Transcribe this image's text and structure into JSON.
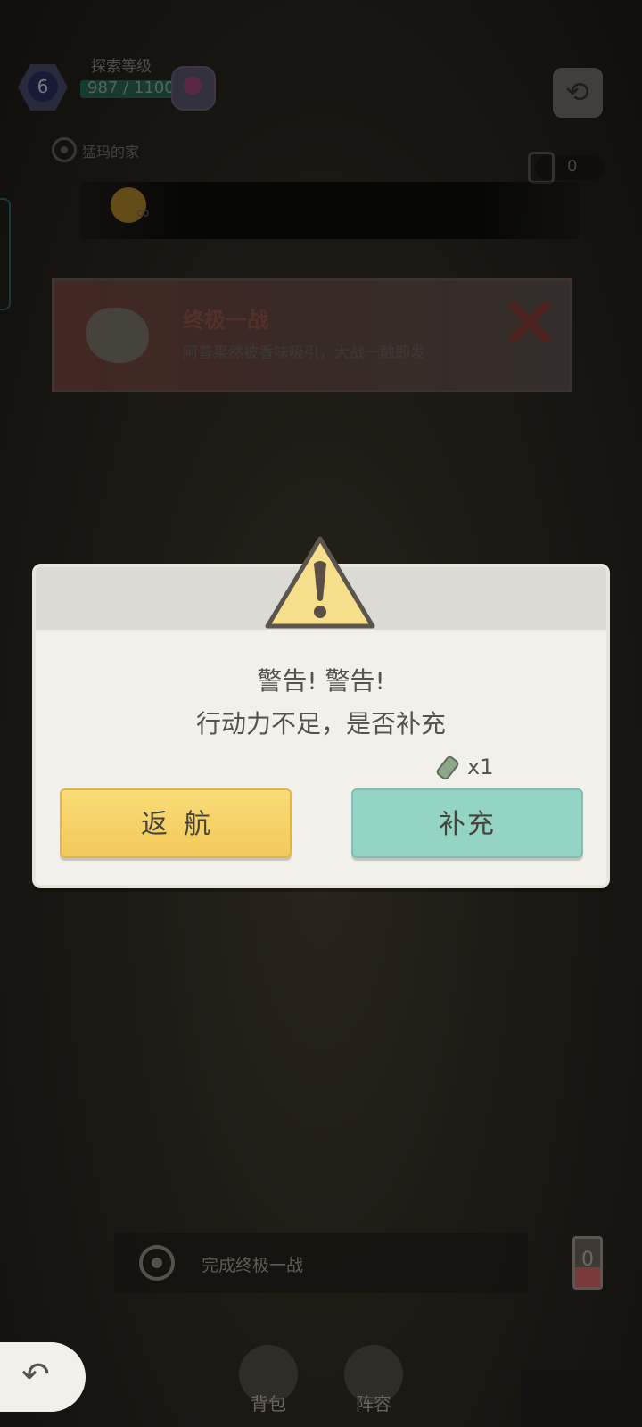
{
  "hud": {
    "level": "6",
    "explore_title": "探索等级",
    "xp": "987 / 1100",
    "location": "猛玛的家",
    "currency_value": "0"
  },
  "event": {
    "title": "终极一战",
    "description": "阿普果然被香味吸引，大战一触即发"
  },
  "dialog": {
    "warning_line1": "警告! 警告!",
    "warning_line2": "行动力不足，是否补充",
    "cost": "x1",
    "return_label": "返航",
    "refill_label": "补充"
  },
  "bottom": {
    "quest_text": "完成终极一战",
    "energy_value": "0",
    "nav": {
      "bag": "背包",
      "team": "阵容"
    }
  },
  "colors": {
    "return_button": "#f5d067",
    "refill_button": "#94d4c5",
    "dialog_bg": "#f2f0ea",
    "warning_fill": "#f6df8a"
  }
}
